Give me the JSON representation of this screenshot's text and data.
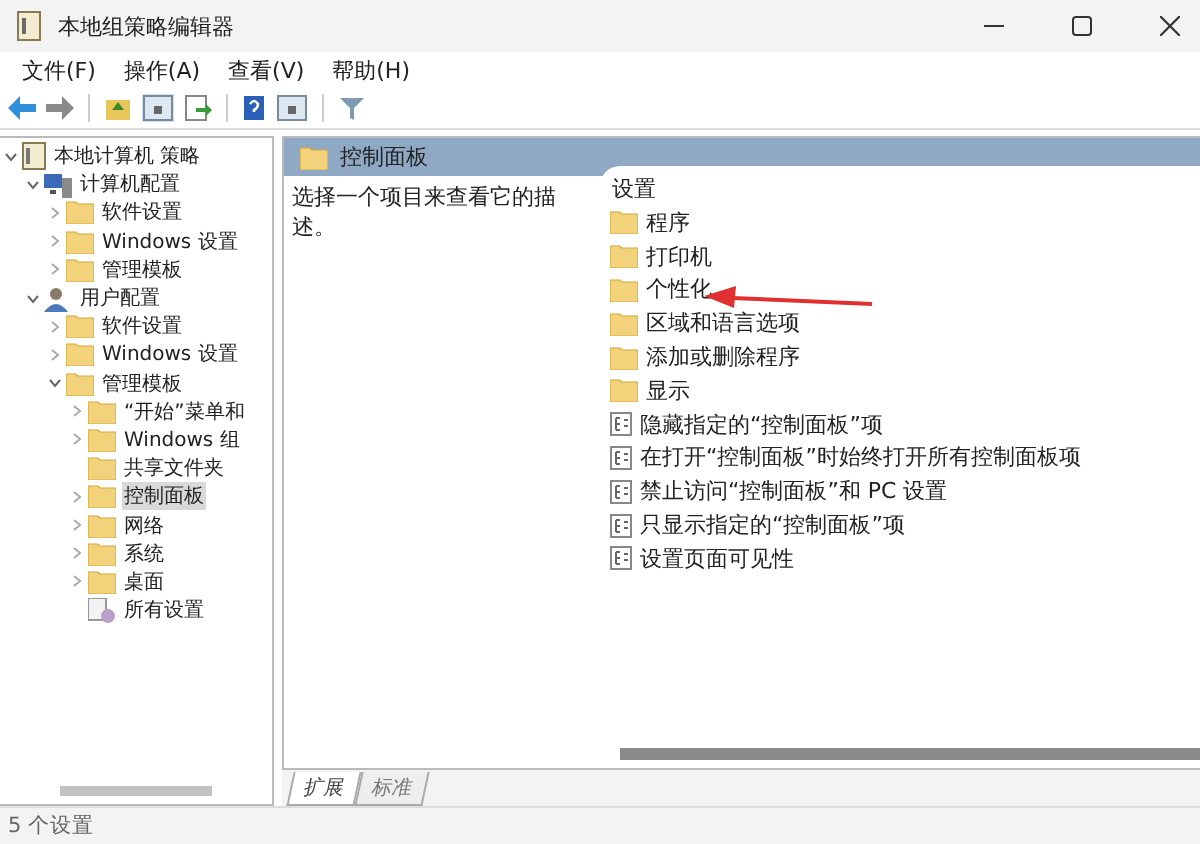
{
  "window": {
    "title": "本地组策略编辑器"
  },
  "menu": [
    "文件(F)",
    "操作(A)",
    "查看(V)",
    "帮助(H)"
  ],
  "tree": [
    {
      "label": "本地计算机 策略",
      "kind": "root",
      "expanded": true,
      "selected": false,
      "children": [
        {
          "label": "计算机配置",
          "kind": "computer",
          "expanded": true,
          "selected": false,
          "children": [
            {
              "label": "软件设置",
              "kind": "folder",
              "expanded": false,
              "selected": false
            },
            {
              "label": "Windows 设置",
              "kind": "folder",
              "expanded": false,
              "selected": false
            },
            {
              "label": "管理模板",
              "kind": "folder",
              "expanded": false,
              "selected": false
            }
          ]
        },
        {
          "label": "用户配置",
          "kind": "user",
          "expanded": true,
          "selected": false,
          "children": [
            {
              "label": "软件设置",
              "kind": "folder",
              "expanded": false,
              "selected": false
            },
            {
              "label": "Windows 设置",
              "kind": "folder",
              "expanded": false,
              "selected": false
            },
            {
              "label": "管理模板",
              "kind": "folder",
              "expanded": true,
              "selected": false,
              "children": [
                {
                  "label": "“开始”菜单和",
                  "kind": "folder",
                  "expanded": false,
                  "selected": false
                },
                {
                  "label": "Windows 组",
                  "kind": "folder",
                  "expanded": false,
                  "selected": false
                },
                {
                  "label": "共享文件夹",
                  "kind": "folder",
                  "selected": false
                },
                {
                  "label": "控制面板",
                  "kind": "folder",
                  "expanded": false,
                  "selected": true
                },
                {
                  "label": "网络",
                  "kind": "folder",
                  "expanded": false,
                  "selected": false
                },
                {
                  "label": "系统",
                  "kind": "folder",
                  "expanded": false,
                  "selected": false
                },
                {
                  "label": "桌面",
                  "kind": "folder",
                  "expanded": false,
                  "selected": false
                },
                {
                  "label": "所有设置",
                  "kind": "settings",
                  "selected": false
                }
              ]
            }
          ]
        }
      ]
    }
  ],
  "pane": {
    "title": "控制面板",
    "description": "选择一个项目来查看它的描述。",
    "column_header": "设置",
    "items": [
      {
        "label": "程序",
        "kind": "folder"
      },
      {
        "label": "打印机",
        "kind": "folder"
      },
      {
        "label": "个性化",
        "kind": "folder"
      },
      {
        "label": "区域和语言选项",
        "kind": "folder"
      },
      {
        "label": "添加或删除程序",
        "kind": "folder"
      },
      {
        "label": "显示",
        "kind": "folder"
      },
      {
        "label": "隐藏指定的“控制面板”项",
        "kind": "setting"
      },
      {
        "label": "在打开“控制面板”时始终打开所有控制面板项",
        "kind": "setting"
      },
      {
        "label": "禁止访问“控制面板”和 PC 设置",
        "kind": "setting"
      },
      {
        "label": "只显示指定的“控制面板”项",
        "kind": "setting"
      },
      {
        "label": "设置页面可见性",
        "kind": "setting"
      }
    ]
  },
  "view_tabs": [
    {
      "label": "扩展",
      "selected": true
    },
    {
      "label": "标准",
      "selected": false
    }
  ],
  "status_bar": "5 个设置"
}
